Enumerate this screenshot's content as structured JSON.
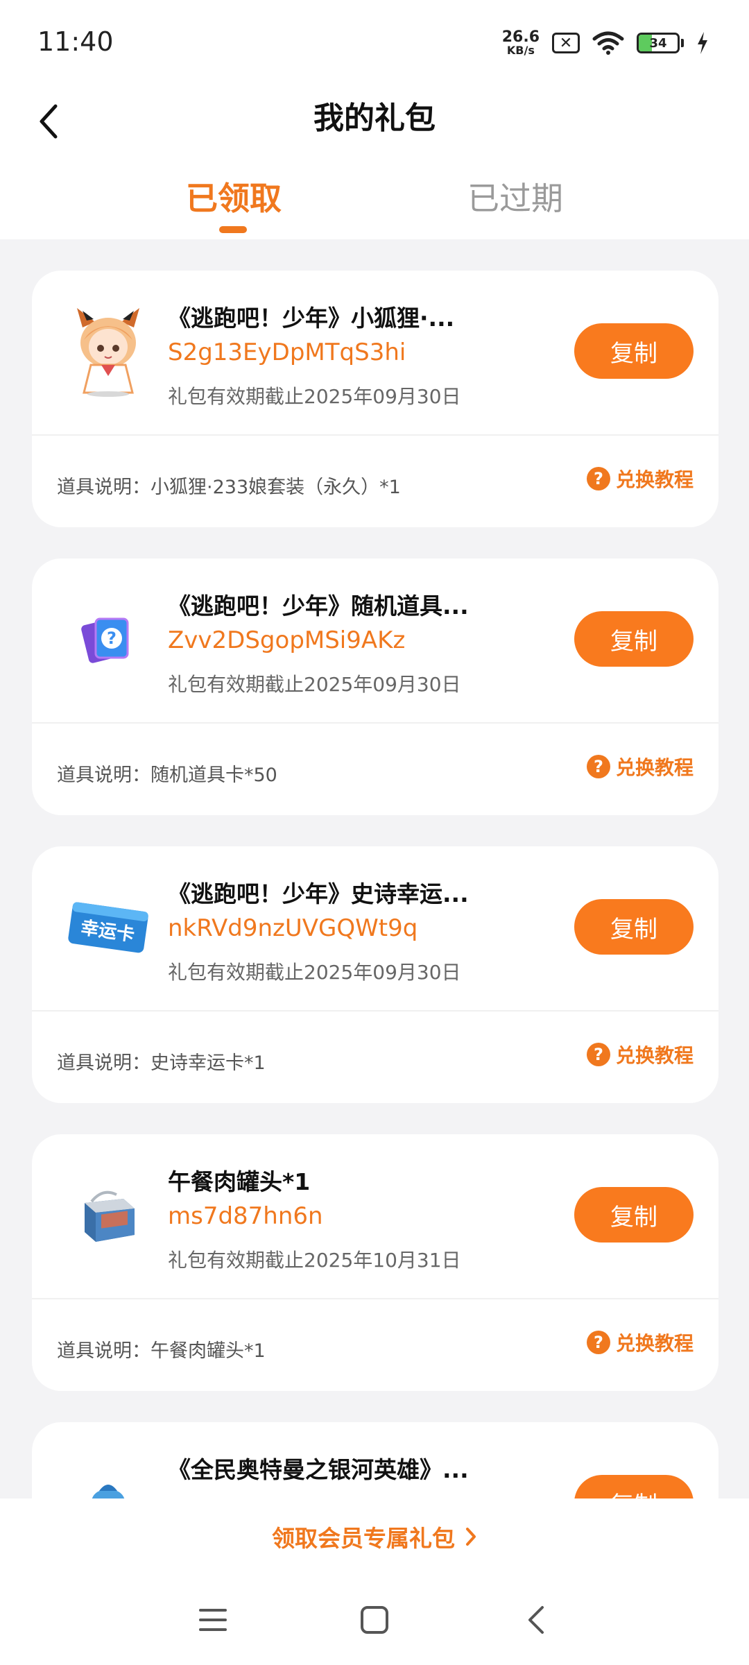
{
  "status_bar": {
    "time": "11:40",
    "net_speed_value": "26.6",
    "net_speed_unit": "KB/s",
    "battery_level": "34",
    "battery_percent": 34
  },
  "header": {
    "title": "我的礼包"
  },
  "tabs": [
    {
      "label": "已领取",
      "active": true
    },
    {
      "label": "已过期",
      "active": false
    }
  ],
  "gifts": [
    {
      "name": "《逃跑吧！少年》小狐狸·...",
      "code": "S2g13EyDpMTqS3hi",
      "expiry": "礼包有效期截止2025年09月30日",
      "desc": "道具说明：小狐狸·233娘套装（永久）*1",
      "copy_label": "复制",
      "tutorial_label": "兑换教程"
    },
    {
      "name": "《逃跑吧！少年》随机道具...",
      "code": "Zvv2DSgopMSi9AKz",
      "expiry": "礼包有效期截止2025年09月30日",
      "desc": "道具说明：随机道具卡*50",
      "copy_label": "复制",
      "tutorial_label": "兑换教程"
    },
    {
      "name": "《逃跑吧！少年》史诗幸运...",
      "code": "nkRVd9nzUVGQWt9q",
      "expiry": "礼包有效期截止2025年09月30日",
      "desc": "道具说明：史诗幸运卡*1",
      "copy_label": "复制",
      "tutorial_label": "兑换教程",
      "thumb_text": "幸运卡"
    },
    {
      "name": "午餐肉罐头*1",
      "code": "ms7d87hn6n",
      "expiry": "礼包有效期截止2025年10月31日",
      "desc": "道具说明：午餐肉罐头*1",
      "copy_label": "复制",
      "tutorial_label": "兑换教程"
    },
    {
      "name": "《全民奥特曼之银河英雄》...",
      "code": "",
      "expiry": "",
      "desc": "",
      "copy_label": "复制",
      "tutorial_label": ""
    }
  ],
  "bottom": {
    "vip_link": "领取会员专属礼包"
  },
  "colors": {
    "accent": "#f0781e",
    "button": "#f97a1e"
  }
}
